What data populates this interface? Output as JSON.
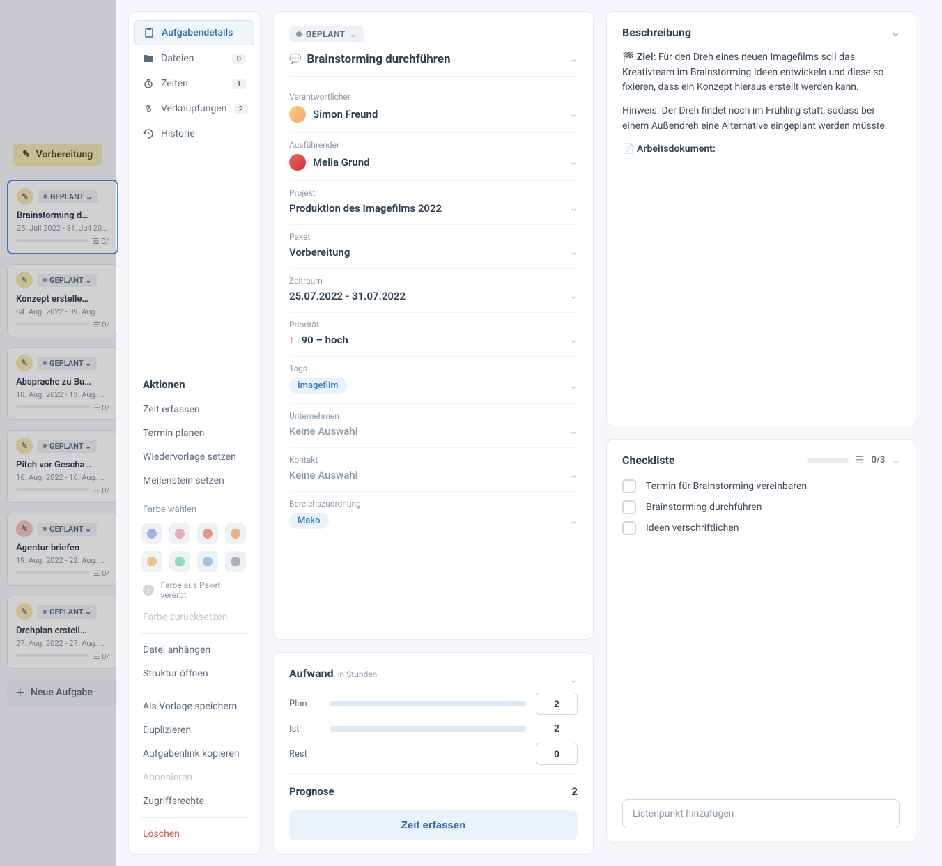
{
  "bg": {
    "header": "Vorbereitung",
    "new_task": "Neue Aufgabe",
    "cards": [
      {
        "status": "GEPLANT",
        "title": "Brainstorming d…",
        "dates": "25. Juli 2022 - 31. Juli 20…",
        "count": "0/",
        "pen": "yellow",
        "active": true
      },
      {
        "status": "GEPLANT",
        "title": "Konzept erstelle…",
        "dates": "04. Aug. 2022 - 09. Aug. …",
        "count": "0/",
        "pen": "yellow"
      },
      {
        "status": "GEPLANT",
        "title": "Absprache zu Bu…",
        "dates": "10. Aug. 2022 - 13. Aug. …",
        "count": "0/",
        "pen": "yellow"
      },
      {
        "status": "GEPLANT",
        "title": "Pitch vor Gescha…",
        "dates": "16. Aug. 2022 - 16. Aug. …",
        "count": "0/",
        "pen": "yellow"
      },
      {
        "status": "GEPLANT",
        "title": "Agentur briefen",
        "dates": "19. Aug. 2022 - 22. Aug. …",
        "count": "0/",
        "pen": "red"
      },
      {
        "status": "GEPLANT",
        "title": "Drehplan erstell…",
        "dates": "27. Aug. 2022 - 27. Aug. …",
        "count": "0/",
        "pen": "yellow"
      }
    ]
  },
  "sidebar": {
    "tabs": [
      {
        "icon": "clipboard",
        "label": "Aufgabendetails",
        "badge": ""
      },
      {
        "icon": "folder",
        "label": "Dateien",
        "badge": "0"
      },
      {
        "icon": "timer",
        "label": "Zeiten",
        "badge": "1"
      },
      {
        "icon": "link",
        "label": "Verknüpfungen",
        "badge": "2"
      },
      {
        "icon": "history",
        "label": "Historie",
        "badge": ""
      }
    ],
    "actions_title": "Aktionen",
    "actions": [
      "Zeit erfassen",
      "Termin planen",
      "Wiedervorlage setzen",
      "Meilenstein setzen"
    ],
    "color_label": "Farbe wählen",
    "color_note": "Farbe aus Paket vererbt",
    "color_reset": "Farbe zurücksetzen",
    "more_actions": [
      "Datei anhängen",
      "Struktur öffnen"
    ],
    "more_actions2": [
      "Als Vorlage speichern",
      "Duplizieren",
      "Aufgabenlink kopieren"
    ],
    "subscribe": "Abonnieren",
    "access": "Zugriffsrechte",
    "delete": "Löschen"
  },
  "details": {
    "status": "GEPLANT",
    "title": "Brainstorming durchführen",
    "fields": {
      "responsible_label": "Verantwortlicher",
      "responsible": "Simon Freund",
      "executor_label": "Ausführender",
      "executor": "Melia Grund",
      "project_label": "Projekt",
      "project": "Produktion des Imagefilms 2022",
      "package_label": "Paket",
      "package": "Vorbereitung",
      "period_label": "Zeitraum",
      "period": "25.07.2022 - 31.07.2022",
      "priority_label": "Priorität",
      "priority": "90 – hoch",
      "tags_label": "Tags",
      "tags": "Imagefilm",
      "company_label": "Unternehmen",
      "company": "Keine Auswahl",
      "contact_label": "Kontakt",
      "contact": "Keine Auswahl",
      "area_label": "Bereichszuordnung",
      "area": "Mako"
    }
  },
  "effort": {
    "title": "Aufwand",
    "subtitle": "in Stunden",
    "plan_label": "Plan",
    "plan": "2",
    "ist_label": "Ist",
    "ist": "2",
    "rest_label": "Rest",
    "rest": "0",
    "prognose_label": "Prognose",
    "prognose": "2",
    "button": "Zeit erfassen"
  },
  "description": {
    "title": "Beschreibung",
    "goal_label": "Ziel:",
    "goal": "Für den Dreh eines neuen Imagefilms soll das Kreativteam im Brainstorming Ideen entwickeln und diese so fixieren, dass ein Konzept hieraus erstellt werden kann.",
    "hint": "Hinweis: Der Dreh findet noch im Frühling statt, sodass bei einem Außendreh eine Alternative eingeplant werden müsste.",
    "doc_label": "Arbeitsdokument:"
  },
  "checklist": {
    "title": "Checkliste",
    "count": "0/3",
    "items": [
      "Termin für Brainstorming vereinbaren",
      "Brainstorming durchführen",
      "Ideen verschriftlichen"
    ],
    "placeholder": "Listenpunkt hinzufügen"
  }
}
